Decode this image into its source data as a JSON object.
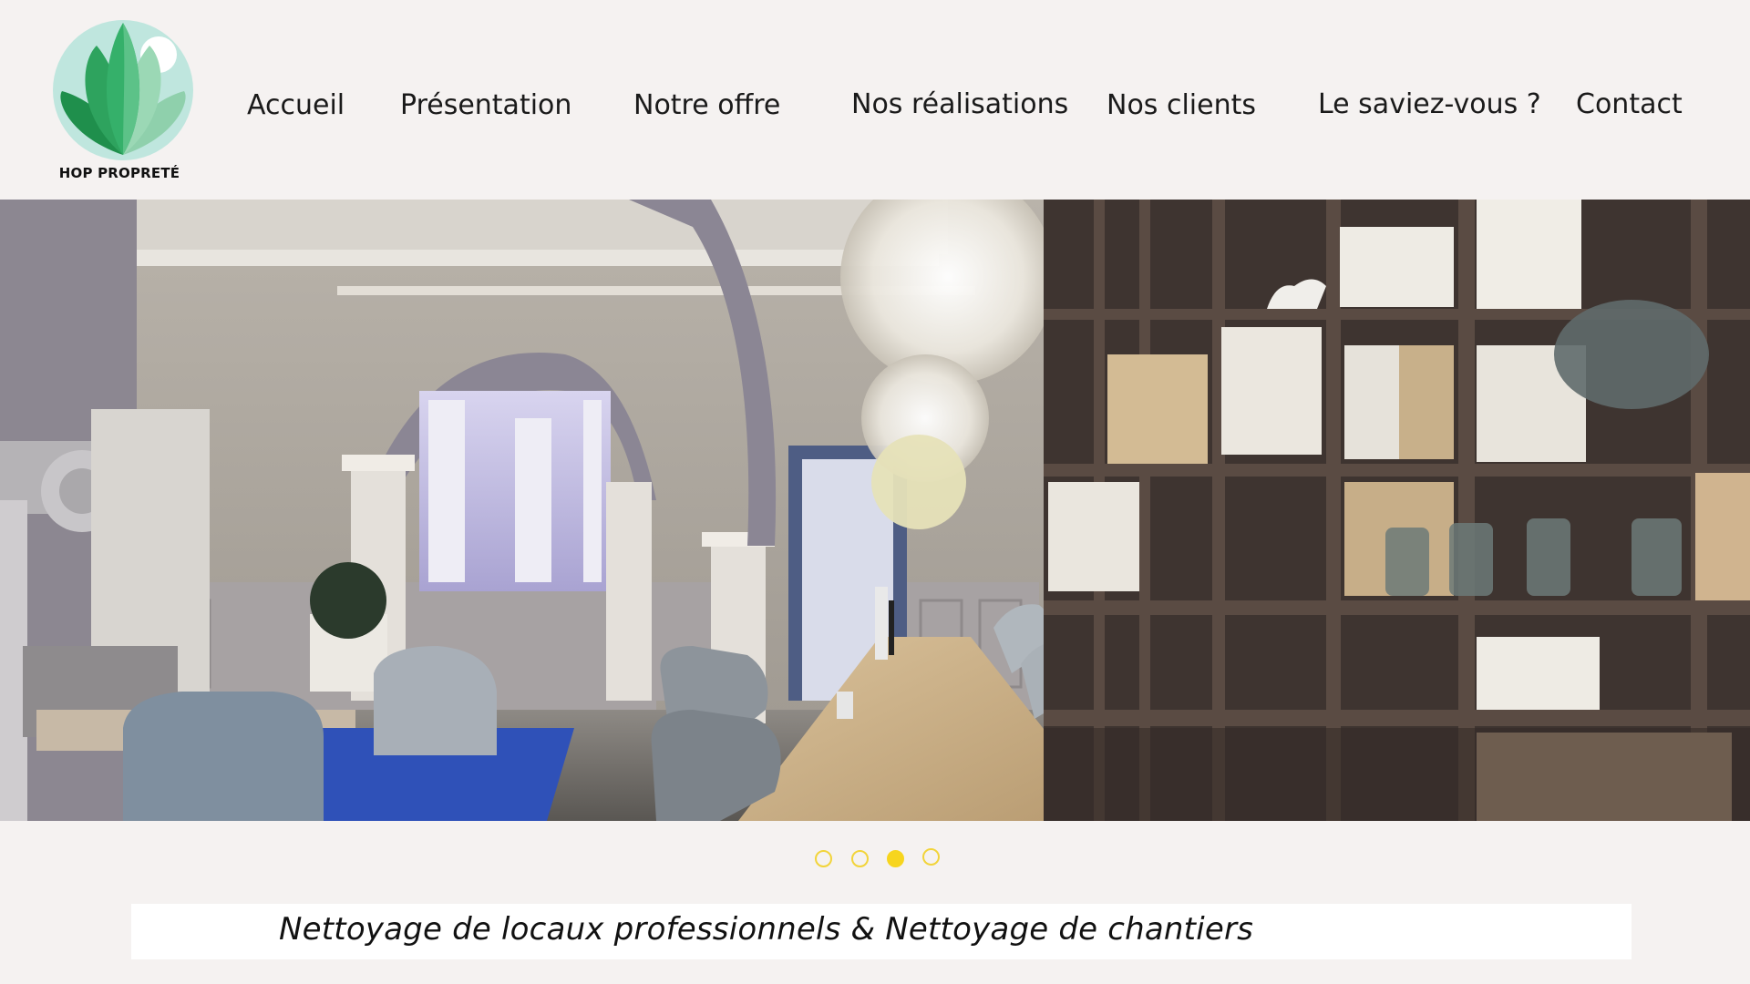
{
  "brand": {
    "name": "HOP PROPRETÉ",
    "colors": {
      "leaf_dark": "#2f9e5b",
      "leaf_light": "#a8dcc0",
      "circle": "#b9e4dc"
    }
  },
  "nav": {
    "items": [
      {
        "label": "Accueil"
      },
      {
        "label": "Présentation"
      },
      {
        "label": "Notre offre"
      },
      {
        "label": "Nos réalisations"
      },
      {
        "label": "Nos clients"
      },
      {
        "label": "Le saviez-vous ?"
      },
      {
        "label": "Contact"
      }
    ]
  },
  "slider": {
    "slide_count": 4,
    "active_index": 2,
    "dot_color": "#f7d51e"
  },
  "tagline": {
    "text": "Nettoyage de locaux professionnels  & Nettoyage de chantiers"
  }
}
